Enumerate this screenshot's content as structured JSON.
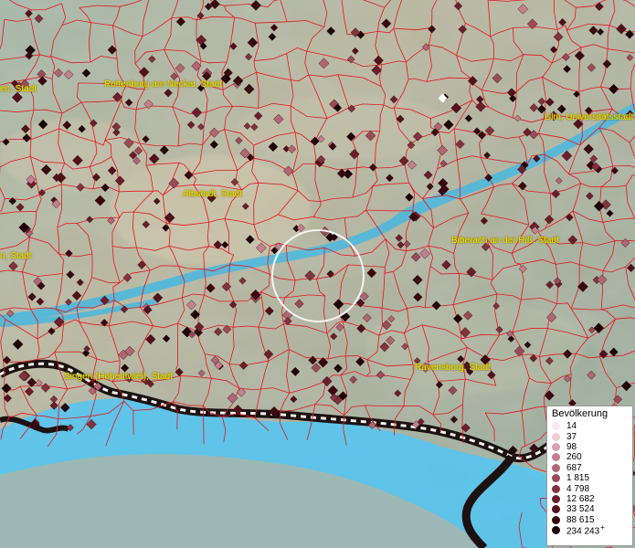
{
  "map": {
    "cities": [
      {
        "name": "Rottenburg am Neckar, Stadt"
      },
      {
        "name": "Ulm, Universitätsstadt"
      },
      {
        "name": "Albstadt, Stadt"
      },
      {
        "name": "Biberach an der Riß, Stadt"
      },
      {
        "name": "Singen (Hohentwiel), Stadt"
      },
      {
        "name": "Ravensburg, Stadt"
      },
      {
        "name": "en, Stadt"
      },
      {
        "name": "n, Stadt"
      }
    ]
  },
  "legend": {
    "title": "Bevölkerung",
    "plus_mark": "+",
    "items": [
      {
        "label": "14",
        "color": "#fbe7ee"
      },
      {
        "label": "37",
        "color": "#efcbd5"
      },
      {
        "label": "98",
        "color": "#d9a2b0"
      },
      {
        "label": "260",
        "color": "#c4808f"
      },
      {
        "label": "687",
        "color": "#b06673"
      },
      {
        "label": "1 815",
        "color": "#9a4b58"
      },
      {
        "label": "4 798",
        "color": "#83323f"
      },
      {
        "label": "12 682",
        "color": "#6b1f2b"
      },
      {
        "label": "33 524",
        "color": "#52111b"
      },
      {
        "label": "88 615",
        "color": "#3a0810"
      },
      {
        "label": "234 243",
        "color": "#1e0206"
      }
    ]
  },
  "colors": {
    "boundary": "#e8141e",
    "water": "#4ab8e0",
    "lake": "#5cc4ec",
    "label": "#f2e600",
    "border_dark": "#1c1111"
  }
}
